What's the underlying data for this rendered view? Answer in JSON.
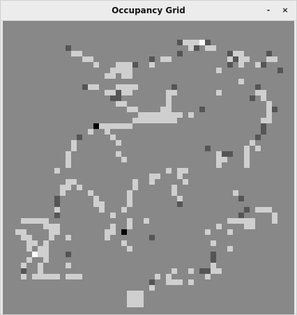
{
  "window": {
    "title": "Occupancy Grid",
    "minimize_label": "-",
    "close_label": "×"
  },
  "colors": {
    "unknown": "#888888",
    "free": "#cfcfcf",
    "occupied_partial": "#555555",
    "occupied": "#000000",
    "highlight": "#ffffff"
  },
  "grid": {
    "cell_codes": {
      "F": "free",
      "D": "occupied_partial",
      "B": "occupied",
      "W": "highlight"
    },
    "rows": [
      "....................................................",
      "....................................................",
      "....................................................",
      "...............................DFFFWD...............",
      "...........D.....................FD.FF..............",
      "............FF.................D........DFF....D....",
      "..............FF..........D.FF..........FDFF...FF...",
      "................F...FFFD..F.............D.F..FD.....",
      "...................FFFF...............F..........D..",
      "..................FF.FF.............................",
      "..........................................F.........",
      "..............DFF...FFFF......D..............D......",
      "..................FFDFF......FF.......F......FF.....",
      "...................DD........F..............D.F.....",
      "....................FF.......F.................F....",
      "......................FF....FF.....D...........FD...",
      "........................FFFFFFFF.F.............F....",
      ".......................FFFFFFFF...............FF....",
      "................BFFFFFF.......................D.....",
      "...............F..F...........................D.....",
      ".............D.....F.........................D......",
      "............F.......F.......................F.......",
      "............F.......................D......F.F......",
      "...........F........F.................FDD..F........",
      "...........F.........F................FF...F........",
      "...........F..........................F....F........",
      ".........F...................F.FF...................",
      "..........................FF...F....................",
      "...........FF..........F..F.....F...................",
      "..........FF.F.........F......F.....................",
      "..........F....F......F.......F..........F..........",
      ".........D......F.....F........F..........D.........",
      ".........D......FF....F........D....................",
      ".........F.......F...F.....................D.FFF....",
      ".........D.........F......................D.....F...",
      "...FFFFF..............F..F..............FFFFF...F....",
      ".......FFF.........F..F...............F....FF.......",
      "..FF....FF........FF.B..............F...F...........",
      "...FF...F..F......F.......D.........................",
      "....FF.F.............F...............F..............",
      "....F.FF..............F.................F...........",
      ".....WFF...D.........................D.............",
      "....F..F.............................D..............",
      "...F..F....F.........................F..............",
      "...D..F.......................F..F.DDFF.............",
      "...F.FFFFF.FFF.............F.F......F...............",
      "..........................D..FFF.F..................",
      "..........................F.........................",
      "......................FFF...........................",
      "......................FFF...........................",
      "......................FFF...........................",
      "....................................................",
      "...................................................."
    ]
  }
}
